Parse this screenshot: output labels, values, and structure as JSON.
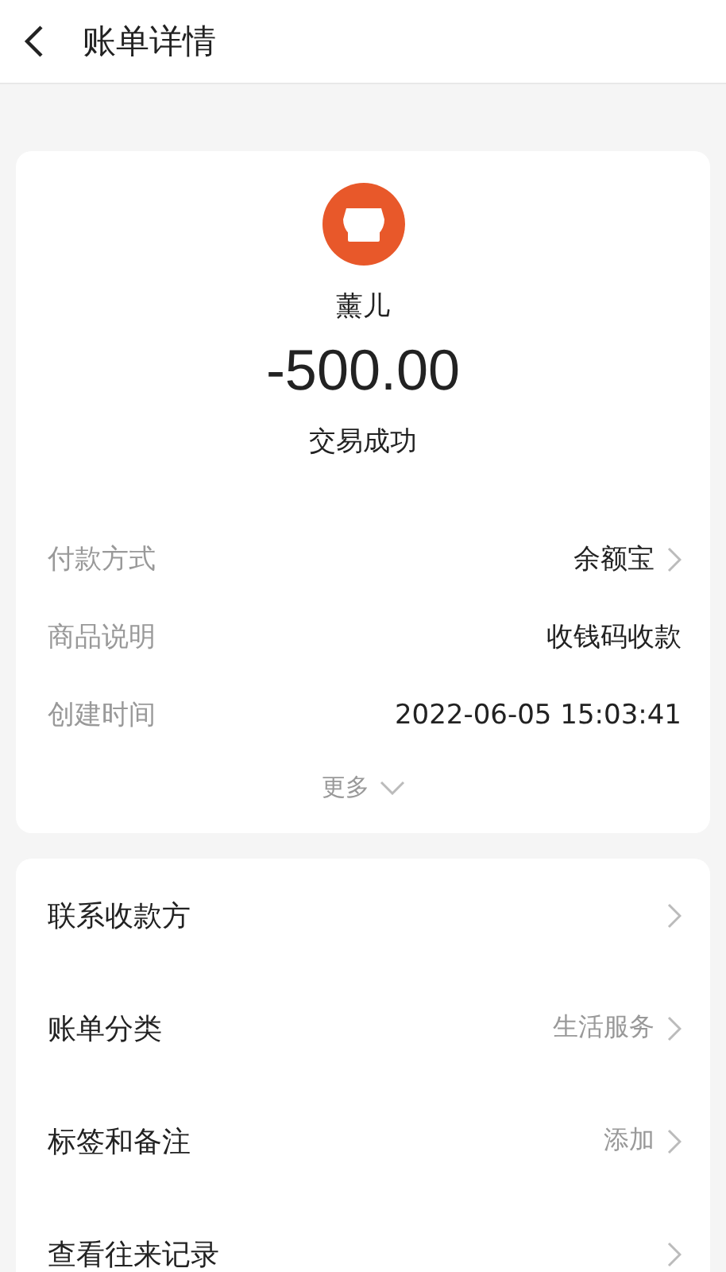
{
  "header": {
    "title": "账单详情"
  },
  "summary": {
    "payee": "薰儿",
    "amount": "-500.00",
    "status": "交易成功"
  },
  "details": [
    {
      "label": "付款方式",
      "value": "余额宝",
      "arrow": true
    },
    {
      "label": "商品说明",
      "value": "收钱码收款",
      "arrow": false
    },
    {
      "label": "创建时间",
      "value": "2022-06-05 15:03:41",
      "arrow": false
    }
  ],
  "more": {
    "label": "更多"
  },
  "actions": [
    {
      "label": "联系收款方"
    },
    {
      "label": "账单分类",
      "value": "生活服务"
    },
    {
      "label": "标签和备注",
      "value": "添加"
    },
    {
      "label": "查看往来记录"
    }
  ]
}
